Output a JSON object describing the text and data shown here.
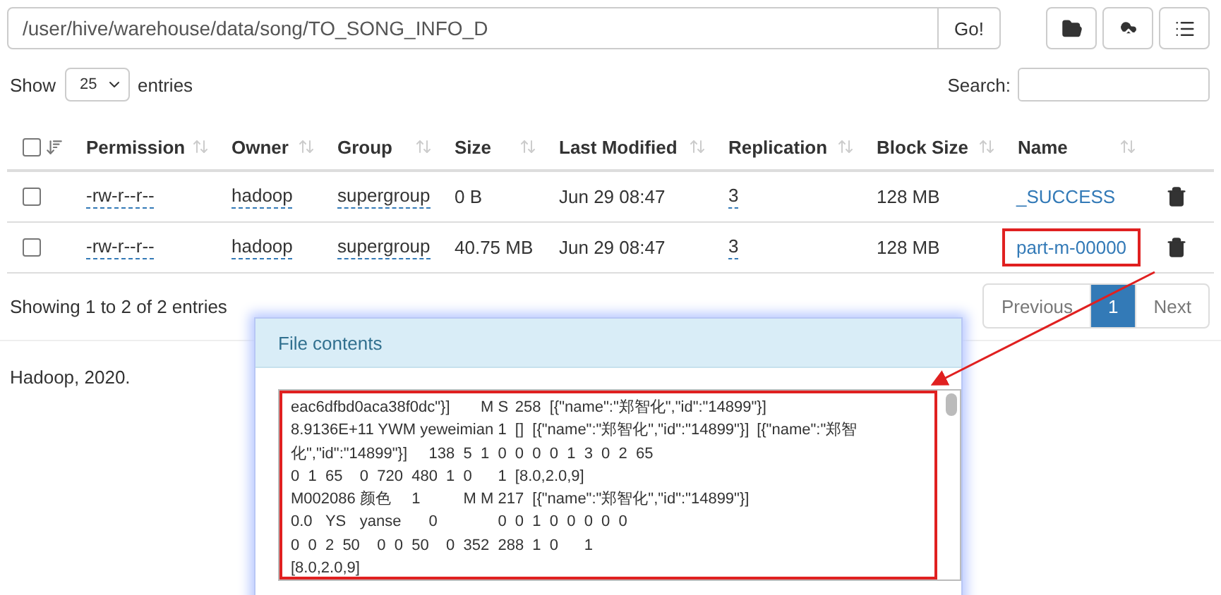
{
  "path_bar": {
    "value": "/user/hive/warehouse/data/song/TO_SONG_INFO_D",
    "go_button": "Go!"
  },
  "length_control": {
    "show_label": "Show",
    "value": "25",
    "entries_label": "entries"
  },
  "search": {
    "label": "Search:"
  },
  "table": {
    "select_all": {
      "checked": false
    },
    "columns": [
      "Permission",
      "Owner",
      "Group",
      "Size",
      "Last Modified",
      "Replication",
      "Block Size",
      "Name"
    ],
    "rows": [
      {
        "checked": false,
        "permission": "-rw-r--r--",
        "owner": "hadoop",
        "group": "supergroup",
        "size": "0 B",
        "modified": "Jun 29 08:47",
        "replication": "3",
        "block_size": "128 MB",
        "name": "_SUCCESS",
        "highlighted": false
      },
      {
        "checked": false,
        "permission": "-rw-r--r--",
        "owner": "hadoop",
        "group": "supergroup",
        "size": "40.75 MB",
        "modified": "Jun 29 08:47",
        "replication": "3",
        "block_size": "128 MB",
        "name": "part-m-00000",
        "highlighted": true
      }
    ]
  },
  "info": "Showing 1 to 2 of 2 entries",
  "pagination": [
    {
      "label": "Previous",
      "selected": false
    },
    {
      "label": "1",
      "selected": true
    },
    {
      "label": "Next",
      "selected": false
    }
  ],
  "footer": "Hadoop, 2020.",
  "dialog": {
    "title": "File contents",
    "highlighted": true,
    "lines": [
      "eac6dfbd0aca38f0dc\"}]\t\tM\tS\t258\t[{\"name\":\"郑智化\",\"id\":\"14899\"}]",
      "8.9136E+11 YWM yeweimian\t1\t[]\t[{\"name\":\"郑智化\",\"id\":\"14899\"}]\t[{\"name\":\"郑智",
      "化\",\"id\":\"14899\"}]\t\t138\t5\t1\t0\t0\t0\t0\t1\t3\t0\t2\t65",
      "0\t1\t65\t0\t720\t480\t1\t0\t\t1\t[8.0,2.0,9]",
      "M002086\t颜色\t\t1\t\t\tM\tM\t217\t[{\"name\":\"郑智化\",\"id\":\"14899\"}]",
      "0.0\tYS\tyanse\t\t0\t\t\t\t0\t0\t1\t0\t0\t0\t0\t0",
      "0\t0\t2\t50\t0\t0\t50\t0\t352\t288\t1\t0\t\t1",
      "[8.0,2.0,9]"
    ]
  }
}
